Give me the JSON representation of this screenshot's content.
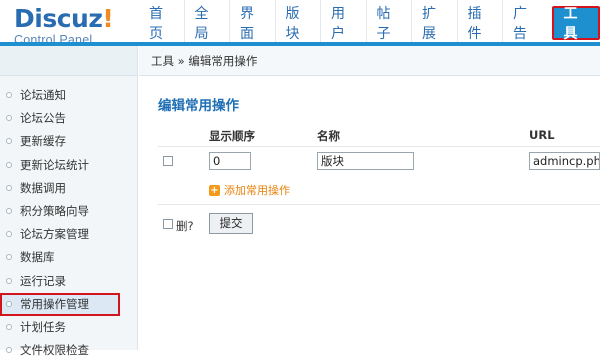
{
  "logo": {
    "brand": "Discuz",
    "bang": "!",
    "subtitle": "Control Panel"
  },
  "nav": {
    "items": [
      {
        "label": "首页"
      },
      {
        "label": "全局"
      },
      {
        "label": "界面"
      },
      {
        "label": "版块"
      },
      {
        "label": "用户"
      },
      {
        "label": "帖子"
      },
      {
        "label": "扩展"
      },
      {
        "label": "插件"
      },
      {
        "label": "广告"
      },
      {
        "label": "工具",
        "active": true
      }
    ]
  },
  "breadcrumb": "工具 » 编辑常用操作",
  "sidebar": {
    "items": [
      {
        "label": "论坛通知"
      },
      {
        "label": "论坛公告"
      },
      {
        "label": "更新缓存"
      },
      {
        "label": "更新论坛统计"
      },
      {
        "label": "数据调用"
      },
      {
        "label": "积分策略向导"
      },
      {
        "label": "论坛方案管理"
      },
      {
        "label": "数据库"
      },
      {
        "label": "运行记录"
      },
      {
        "label": "常用操作管理",
        "active": true
      },
      {
        "label": "计划任务"
      },
      {
        "label": "文件权限检查"
      }
    ]
  },
  "main": {
    "title": "编辑常用操作",
    "columns": {
      "order": "显示顺序",
      "name": "名称",
      "url": "URL"
    },
    "rows": [
      {
        "order": "0",
        "name": "版块",
        "url": "admincp.php?"
      }
    ],
    "add_label": "添加常用操作",
    "delete_label": "删?",
    "submit_label": "提交"
  },
  "colors": {
    "accent": "#1e90d0",
    "highlight": "#d2151d",
    "link": "#e8820c",
    "title": "#1f6fb5"
  }
}
